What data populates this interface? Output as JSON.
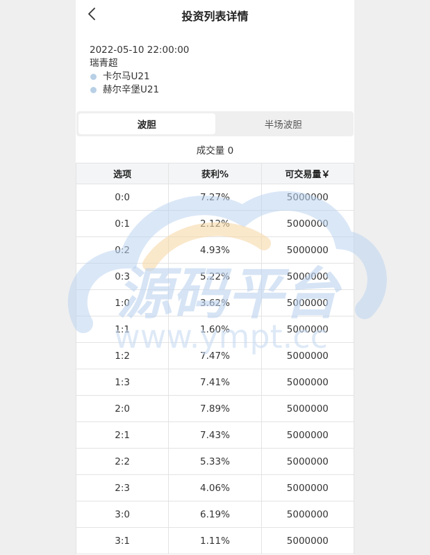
{
  "header": {
    "title": "投资列表详情",
    "back_icon": "chevron-left-icon"
  },
  "match": {
    "datetime": "2022-05-10 22:00:00",
    "league": "瑞青超",
    "home_team": "卡尔马U21",
    "away_team": "赫尔辛堡U21",
    "team_dot_color": "#b8d0e6"
  },
  "tabs": [
    {
      "label": "波胆",
      "active": true
    },
    {
      "label": "半场波胆",
      "active": false
    }
  ],
  "volume": {
    "label": "成交量 0"
  },
  "table": {
    "columns": [
      "选项",
      "获利%",
      "可交易量￥"
    ],
    "rows": [
      [
        "0:0",
        "7.27%",
        "5000000"
      ],
      [
        "0:1",
        "2.12%",
        "5000000"
      ],
      [
        "0:2",
        "4.93%",
        "5000000"
      ],
      [
        "0:3",
        "5.22%",
        "5000000"
      ],
      [
        "1:0",
        "3.62%",
        "5000000"
      ],
      [
        "1:1",
        "1.60%",
        "5000000"
      ],
      [
        "1:2",
        "7.47%",
        "5000000"
      ],
      [
        "1:3",
        "7.41%",
        "5000000"
      ],
      [
        "2:0",
        "7.89%",
        "5000000"
      ],
      [
        "2:1",
        "7.43%",
        "5000000"
      ],
      [
        "2:2",
        "5.33%",
        "5000000"
      ],
      [
        "2:3",
        "4.06%",
        "5000000"
      ],
      [
        "3:0",
        "6.19%",
        "5000000"
      ],
      [
        "3:1",
        "1.11%",
        "5000000"
      ]
    ]
  },
  "watermark": {
    "text": "源码平台",
    "url": "www.ympt.cc",
    "color": "#bcd3f0",
    "accent_color": "#f6d9a8"
  }
}
